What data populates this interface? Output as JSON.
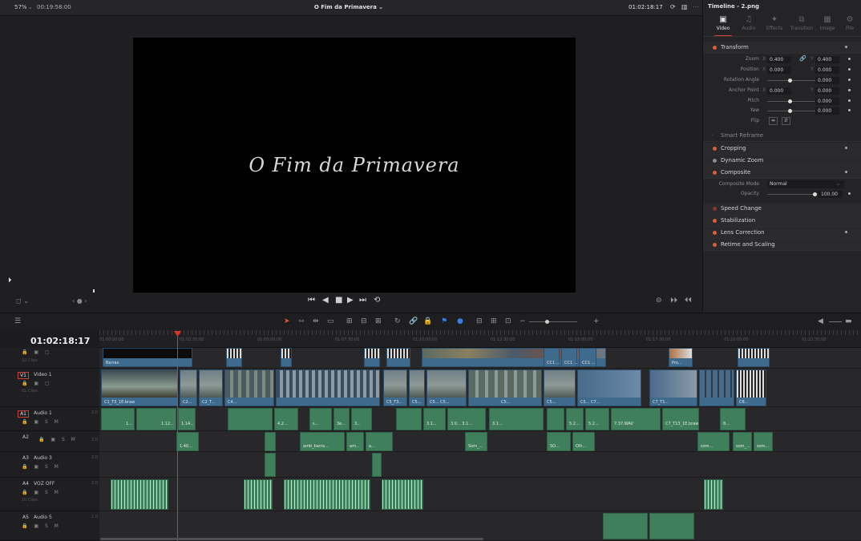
{
  "topbar": {
    "zoom": "57%",
    "zoom_chevron": "⌄",
    "source_timecode": "00:19:58:00",
    "timeline_title": "O Fim da Primavera ⌄",
    "current_timecode": "01:02:18:17",
    "icons": [
      "refresh-icon",
      "layout-icon",
      "more-icon"
    ]
  },
  "viewer": {
    "title_card_text": "O Fim da Primavera",
    "flag_glyph": "⏵"
  },
  "transport": {
    "left_label": "◻ ⌄",
    "nav_label": "‹ ● ›",
    "controls": [
      "⏮",
      "◀",
      "■",
      "▶",
      "⏭",
      "⟲"
    ],
    "right_controls": [
      "⊖",
      "⏵⏵",
      "⏴⏴"
    ]
  },
  "inspector": {
    "header": "Timeline - 2.png",
    "tabs": [
      {
        "label": "Video",
        "icon": "▣",
        "active": true
      },
      {
        "label": "Audio",
        "icon": "♫",
        "active": false
      },
      {
        "label": "Effects",
        "icon": "✦",
        "active": false
      },
      {
        "label": "Transition",
        "icon": "⧉",
        "active": false
      },
      {
        "label": "Image",
        "icon": "▦",
        "active": false
      },
      {
        "label": "File",
        "icon": "⚙",
        "active": false
      }
    ],
    "transform": {
      "title": "Transform",
      "zoom_label": "Zoom",
      "zoom_x": "0.400",
      "zoom_y": "0.400",
      "position_label": "Position",
      "position_x": "0.000",
      "position_y": "0.000",
      "rotation_label": "Rotation Angle",
      "rotation_value": "0.000",
      "anchor_label": "Anchor Point",
      "anchor_x": "0.000",
      "anchor_y": "0.000",
      "pitch_label": "Pitch",
      "pitch_value": "0.000",
      "yaw_label": "Yaw",
      "yaw_value": "0.000",
      "flip_label": "Flip",
      "x_axis": "X",
      "y_axis": "Y"
    },
    "smart_reframe": "Smart Reframe",
    "cropping": "Cropping",
    "dynamic_zoom": "Dynamic Zoom",
    "composite": {
      "title": "Composite",
      "mode_label": "Composite Mode",
      "mode_value": "Normal",
      "opacity_label": "Opacity",
      "opacity_value": "100.00"
    },
    "speed_change": "Speed Change",
    "stabilization": "Stabilization",
    "lens_correction": "Lens Correction",
    "retime_scaling": "Retime and Scaling"
  },
  "timeline": {
    "timecode": "01:02:18:17",
    "ruler_labels": [
      "01:00:00:00",
      "01:02:30:00",
      "01:05:00:00",
      "01:07:30:00",
      "01:10:00:00",
      "01:12:30:00",
      "01:15:00:00",
      "01:17:30:00",
      "01:20:00:00",
      "01:22:30:00"
    ],
    "tracks": {
      "v2": {
        "clips_label": "10 Clips",
        "icons": "🔒 ▣ ▢"
      },
      "v1": {
        "id": "V1",
        "name": "Video 1",
        "clips_label": "81 Clips",
        "icons": "🔒 ▣ ▢"
      },
      "a1": {
        "id": "A1",
        "name": "Audio 1",
        "num": "2.0",
        "icons": "🔒 ▣ S M"
      },
      "a2": {
        "id": "A2",
        "name": "",
        "num": "2.0",
        "icons": "🔒 ▣ S M"
      },
      "a3": {
        "id": "A3",
        "name": "Audio 3",
        "num": "2.0",
        "icons": "🔒 ▣ S M"
      },
      "a4": {
        "id": "A4",
        "name": "VOZ OFF",
        "num": "2.0",
        "clips_label": "10 Clips",
        "icons": "🔒 ▣ S M"
      },
      "a5": {
        "id": "A5",
        "name": "Audio 5",
        "num": "1.0",
        "icons": "🔒 ▣ S M"
      }
    },
    "clip_labels": {
      "v2_barras": "Barras",
      "v2_cc1": "CC1 ...",
      "v2_cc2": "CC1 ...",
      "v2_cc3": "CC1 ...",
      "v2_pro": "Pro...",
      "v1_first": "C1_T3_1E.braw",
      "v1_c2": "C2...",
      "v1_c3": "C2_T...",
      "v1_c4": "C4...",
      "v1_c5": "C5_T3...",
      "v1_c6": "C5...",
      "v1_c7": "C5... C5...",
      "v1_c8": "C5...",
      "v1_c9": "C5...",
      "v1_c10": "C5... C7...",
      "v1_c11": "C7_T1...",
      "v1_c12": "C8...",
      "a1_a": "1...",
      "a1_b": "1.12...",
      "a1_c": "1.14...",
      "a1_d": "4.2...",
      "a1_e": "s...",
      "a1_f": "3e...",
      "a1_g": "3...",
      "a1_h": "3.1...",
      "a1_i": "3.0... 3.1...",
      "a1_j": "3.1...",
      "a1_k": "5.2...",
      "a1_l": "5.2...",
      "a1_m": "7.37.WAV",
      "a1_n": "C7_T13_1E.braw",
      "a1_o": "8...",
      "a2_a": "1.40...",
      "a2_b": "amb_barra...",
      "a2_c": "am...",
      "a2_d": "a...",
      "a2_e": "Som_...",
      "a2_f": "SO...",
      "a2_g": "Olh...",
      "a2_h": "som...",
      "a2_i": "som_...",
      "a2_j": "som..."
    }
  }
}
